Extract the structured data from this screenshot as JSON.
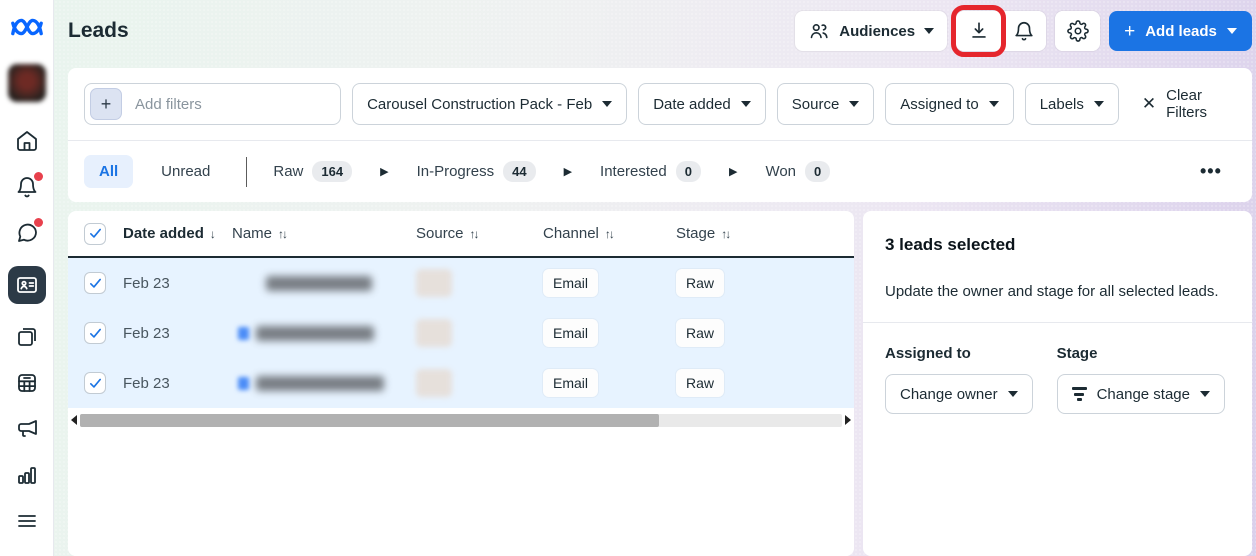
{
  "page": {
    "title": "Leads"
  },
  "topbar": {
    "audiences_label": "Audiences",
    "add_leads_label": "Add leads",
    "add_leads_plus": "+",
    "annotation": {
      "shape": "red-rounded-rectangle",
      "color": "#e5262d",
      "target": "export-leads-button"
    }
  },
  "filters": {
    "add_filters_placeholder": "Add filters",
    "plus_label": "+",
    "form_selector_value": "Carousel Construction Pack - Feb",
    "dropdowns": [
      "Date added",
      "Source",
      "Assigned to",
      "Labels"
    ],
    "clear_label": "Clear Filters",
    "clear_icon": "✕"
  },
  "tabs": {
    "all_label": "All",
    "unread_label": "Unread",
    "stages": [
      {
        "label": "Raw",
        "count": "164"
      },
      {
        "label": "In-Progress",
        "count": "44"
      },
      {
        "label": "Interested",
        "count": "0"
      },
      {
        "label": "Won",
        "count": "0"
      }
    ],
    "stage_arrow": "▶",
    "overflow_label": "•••"
  },
  "table": {
    "headers": {
      "date": "Date added",
      "name": "Name",
      "source": "Source",
      "channel": "Channel",
      "stage": "Stage"
    },
    "sort_desc_glyph": "↓",
    "sort_both_glyph": "↑↓",
    "rows": [
      {
        "date": "Feb 23",
        "name_redacted": true,
        "source_redacted": true,
        "channel": "Email",
        "stage": "Raw",
        "selected": true
      },
      {
        "date": "Feb 23",
        "name_redacted": true,
        "source_redacted": true,
        "channel": "Email",
        "stage": "Raw",
        "selected": true
      },
      {
        "date": "Feb 23",
        "name_redacted": true,
        "source_redacted": true,
        "channel": "Email",
        "stage": "Raw",
        "selected": true
      }
    ]
  },
  "panel": {
    "title": "3 leads selected",
    "description": "Update the owner and stage for all selected leads.",
    "assigned_to_label": "Assigned to",
    "change_owner_label": "Change owner",
    "stage_label": "Stage",
    "change_stage_label": "Change stage"
  },
  "sidebar": {
    "items": [
      {
        "name": "home",
        "badge": false
      },
      {
        "name": "notifications",
        "badge": true
      },
      {
        "name": "messages",
        "badge": true
      },
      {
        "name": "leads",
        "active": true
      },
      {
        "name": "pages",
        "badge": false
      },
      {
        "name": "planner",
        "badge": false
      },
      {
        "name": "ads",
        "badge": false
      },
      {
        "name": "insights",
        "badge": false
      },
      {
        "name": "all-tools",
        "badge": false
      }
    ]
  },
  "colors": {
    "accent_blue": "#1b74e4",
    "selected_row": "#e7f3ff",
    "annotation_red": "#e5262d",
    "active_nav": "#2c3a47"
  }
}
